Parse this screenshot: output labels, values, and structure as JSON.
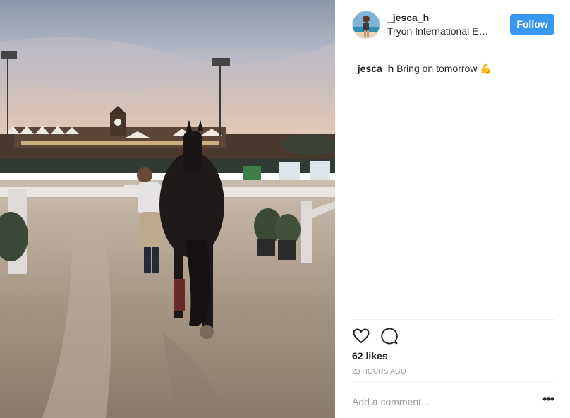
{
  "post": {
    "username": "_jesca_h",
    "location": "Tryon International Equestrian Center",
    "follow_label": "Follow",
    "caption_user": "_jesca_h",
    "caption_text": "Bring on tomorrow 💪",
    "likes": "62 likes",
    "time": "23 HOURS AGO",
    "comment_placeholder": "Add a comment...",
    "more_label": "•••"
  },
  "colors": {
    "accent": "#3897f0",
    "text": "#262626",
    "muted": "#999999",
    "divider": "#efefef"
  },
  "icons": {
    "like": "heart-icon",
    "comment": "comment-bubble-icon",
    "more": "more-options-icon"
  }
}
